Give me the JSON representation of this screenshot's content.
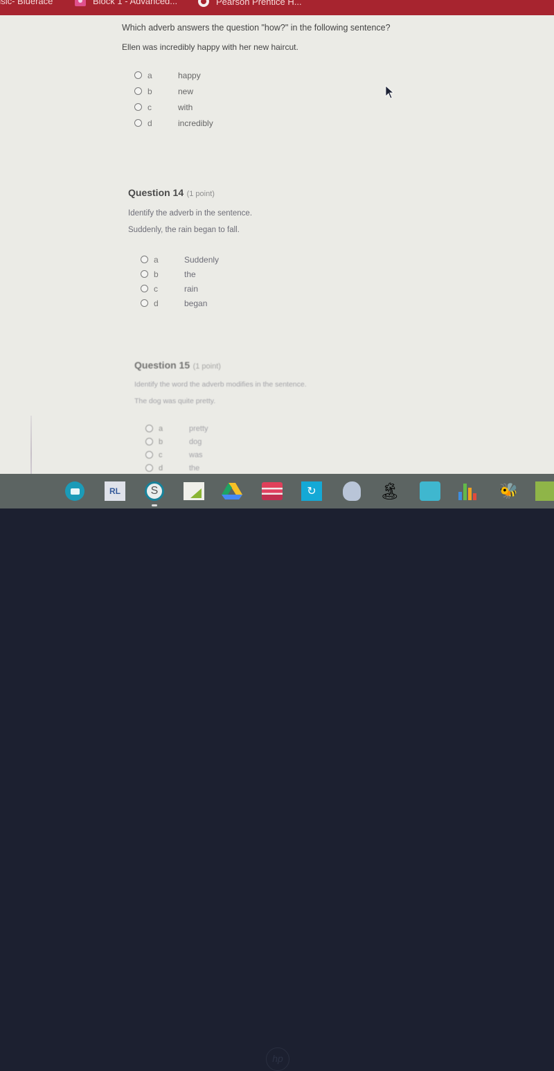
{
  "browser": {
    "bookmarks": [
      {
        "label": "usic- Bluerace",
        "icon": "bookmark-icon"
      },
      {
        "label": "Block 1 - Advanced...",
        "icon": "classroom-icon"
      },
      {
        "label": "Pearson Prentice H...",
        "icon": "pearson-icon"
      }
    ]
  },
  "colors": {
    "bookmark_bar": "#a7242f",
    "page_bg": "#ebebe6",
    "shelf_bg": "#5c6462",
    "bezel": "#1c2030"
  },
  "questions": [
    {
      "title": "",
      "points": "",
      "prompt": "Which adverb answers the question \"how?\" in the following sentence?",
      "sentence": "Ellen was incredibly happy with her new haircut.",
      "options": [
        {
          "letter": "a",
          "text": "happy"
        },
        {
          "letter": "b",
          "text": "new"
        },
        {
          "letter": "c",
          "text": "with"
        },
        {
          "letter": "d",
          "text": "incredibly"
        }
      ]
    },
    {
      "title": "Question 14",
      "points": "(1 point)",
      "prompt": "Identify the adverb in the sentence.",
      "sentence": "Suddenly, the rain began to fall.",
      "options": [
        {
          "letter": "a",
          "text": "Suddenly"
        },
        {
          "letter": "b",
          "text": "the"
        },
        {
          "letter": "c",
          "text": "rain"
        },
        {
          "letter": "d",
          "text": "began"
        }
      ]
    },
    {
      "title": "Question 15",
      "points": "(1 point)",
      "prompt": "Identify the word the adverb modifies in the sentence.",
      "sentence": "The dog was quite pretty.",
      "options": [
        {
          "letter": "a",
          "text": "pretty"
        },
        {
          "letter": "b",
          "text": "dog"
        },
        {
          "letter": "c",
          "text": "was"
        },
        {
          "letter": "d",
          "text": "the"
        }
      ]
    }
  ],
  "shelf": {
    "apps": [
      {
        "name": "google-meet",
        "label": ""
      },
      {
        "name": "readlang",
        "label": "RL"
      },
      {
        "name": "schoology",
        "label": "S"
      },
      {
        "name": "sheets-signal",
        "label": ""
      },
      {
        "name": "google-drive",
        "label": ""
      },
      {
        "name": "books-stack",
        "label": ""
      },
      {
        "name": "swirl-app",
        "label": "↻"
      },
      {
        "name": "head-profile",
        "label": ""
      },
      {
        "name": "island",
        "label": "🏝"
      },
      {
        "name": "map-app",
        "label": ""
      },
      {
        "name": "bar-chart-app",
        "label": ""
      },
      {
        "name": "bee-mascot",
        "label": "🐝"
      },
      {
        "name": "green-app",
        "label": ""
      }
    ]
  },
  "device": {
    "logo": "hp"
  }
}
